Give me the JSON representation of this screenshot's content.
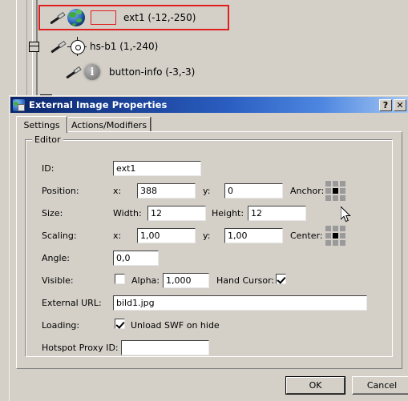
{
  "tree": {
    "items": [
      {
        "label": "ext1 (-12,-250)",
        "icons": [
          "pen-icon",
          "globe-icon",
          "red-rect-swatch"
        ],
        "selected": true
      },
      {
        "label": "hs-b1 (1,-240)",
        "icons": [
          "expand-box-icon",
          "pen-icon",
          "crosshair-icon"
        ],
        "selected": false
      },
      {
        "label": "button-info (-3,-3)",
        "icons": [
          "pen-icon",
          "info-icon"
        ],
        "selected": false
      }
    ],
    "selection_color": "#e02020"
  },
  "dialog": {
    "title": "External Image Properties",
    "title_icon": "image-globe-icon",
    "titlebar_color": "#0a246a",
    "buttons": {
      "help": "?",
      "close": "✕"
    },
    "tabs": [
      {
        "label": "Settings",
        "active": true
      },
      {
        "label": "Actions/Modifiers",
        "active": false
      }
    ],
    "group": {
      "title": "Editor"
    },
    "fields": {
      "id": {
        "label": "ID:",
        "value": "ext1"
      },
      "position": {
        "label": "Position:",
        "x_label": "x:",
        "x_value": "388",
        "y_label": "y:",
        "y_value": "0"
      },
      "anchor": {
        "label": "Anchor:",
        "selected_cell": 4
      },
      "size": {
        "label": "Size:",
        "width_label": "Width:",
        "width_value": "12",
        "height_label": "Height:",
        "height_value": "12"
      },
      "scaling": {
        "label": "Scaling:",
        "x_label": "x:",
        "x_value": "1,00",
        "y_label": "y:",
        "y_value": "1,00"
      },
      "center": {
        "label": "Center:",
        "selected_cell": 4
      },
      "angle": {
        "label": "Angle:",
        "value": "0,0"
      },
      "visible": {
        "label": "Visible:",
        "checked": false
      },
      "alpha": {
        "label": "Alpha:",
        "value": "1,000"
      },
      "hand_cursor": {
        "label": "Hand Cursor:",
        "checked": true
      },
      "external_url": {
        "label": "External URL:",
        "value": "bild1.jpg"
      },
      "loading": {
        "label": "Loading:",
        "checkbox_label": "Unload SWF on hide",
        "checked": true
      },
      "hotspot_proxy_id": {
        "label": "Hotspot Proxy ID:",
        "value": ""
      }
    },
    "footer": {
      "ok": "OK",
      "cancel": "Cancel"
    }
  }
}
